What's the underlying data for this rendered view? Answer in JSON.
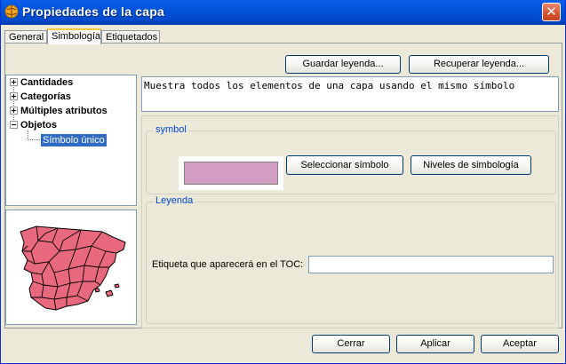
{
  "window": {
    "title": "Propiedades de la capa",
    "close_glyph": "✕"
  },
  "colors": {
    "titlebar": "#0054E3",
    "selection": "#316AC5",
    "symbol_fill": "#D39CC3",
    "map_fill": "#E8697E",
    "group_label": "#0046D5"
  },
  "tabs": [
    {
      "label": "General"
    },
    {
      "label": "Simbología",
      "active": true
    },
    {
      "label": "Etiquetados"
    }
  ],
  "toolbar": {
    "save_label": "Guardar leyenda...",
    "load_label": "Recuperar leyenda..."
  },
  "tree": {
    "items": [
      {
        "label": "Cantidades",
        "icon": "expand-plus-icon"
      },
      {
        "label": "Categorías",
        "icon": "expand-plus-icon"
      },
      {
        "label": "Múltiples atributos",
        "icon": "expand-plus-icon"
      },
      {
        "label": "Objetos",
        "icon": "collapse-minus-icon"
      }
    ],
    "selected_leaf": "Símbolo único"
  },
  "description": "Muestra todos los elementos de una capa usando el mismo símbolo",
  "symbol_group": {
    "title": "symbol",
    "select_label": "Seleccionar símbolo",
    "levels_label": "Niveles de simbología"
  },
  "legend_group": {
    "title": "Leyenda",
    "toc_label": "Etiqueta que aparecerá en el TOC:",
    "toc_value": ""
  },
  "footer": {
    "close_label": "Cerrar",
    "apply_label": "Aplicar",
    "accept_label": "Aceptar"
  }
}
